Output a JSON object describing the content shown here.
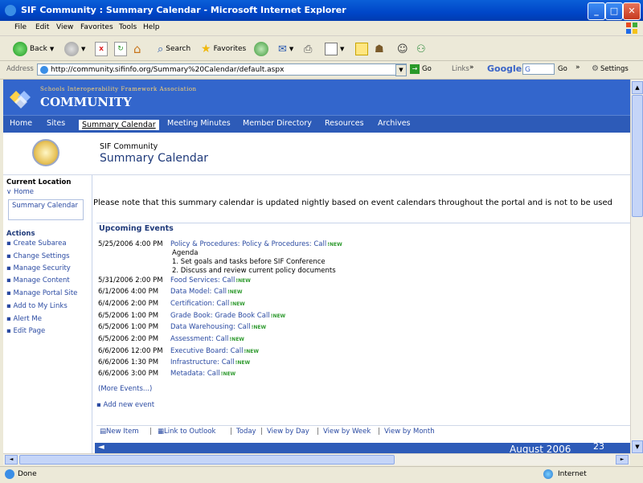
{
  "window": {
    "title": "SIF Community : Summary Calendar - Microsoft Internet Explorer"
  },
  "menu": [
    "File",
    "Edit",
    "View",
    "Favorites",
    "Tools",
    "Help"
  ],
  "toolbar": {
    "back": "Back",
    "search": "Search",
    "favorites": "Favorites"
  },
  "address": {
    "label": "Address",
    "url": "http://community.sifinfo.org/Summary%20Calendar/default.aspx",
    "go": "Go",
    "links": "Links",
    "google": "Google",
    "google_input": "G",
    "google_go": "Go",
    "settings": "Settings"
  },
  "site": {
    "logo_top": "Schools Interoperability Framework Association",
    "logo_main": "COMMUNITY",
    "nav": [
      "Home",
      "Sites",
      "Summary Calendar",
      "Meeting Minutes",
      "Member Directory",
      "Resources",
      "Archives"
    ],
    "site_name": "SIF Community",
    "page_title": "Summary Calendar"
  },
  "left": {
    "current_location": "Current Location",
    "home": "Home",
    "current": "Summary Calendar",
    "actions_title": "Actions",
    "actions": [
      "Create Subarea",
      "Change Settings",
      "Manage Security",
      "Manage Content",
      "Manage Portal Site",
      "Add to My Links",
      "Alert Me",
      "Edit Page"
    ]
  },
  "notice": "Please note that this summary calendar is updated nightly based on event calendars throughout the portal and is not to be used",
  "events": {
    "title": "Upcoming Events",
    "new_label": "NEW",
    "items": [
      {
        "date": "5/25/2006 4:00 PM",
        "title": "Policy & Procedures: Policy & Procedures: Call"
      },
      {
        "date": "5/31/2006 2:00 PM",
        "title": "Food Services: Call"
      },
      {
        "date": "6/1/2006 4:00 PM",
        "title": "Data Model: Call"
      },
      {
        "date": "6/4/2006 2:00 PM",
        "title": "Certification: Call"
      },
      {
        "date": "6/5/2006 1:00 PM",
        "title": "Grade Book: Grade Book Call"
      },
      {
        "date": "6/5/2006 1:00 PM",
        "title": "Data Warehousing: Call"
      },
      {
        "date": "6/5/2006 2:00 PM",
        "title": "Assessment: Call"
      },
      {
        "date": "6/6/2006 12:00 PM",
        "title": "Executive Board: Call"
      },
      {
        "date": "6/6/2006 1:30 PM",
        "title": "Infrastructure: Call"
      },
      {
        "date": "6/6/2006 3:00 PM",
        "title": "Metadata: Call"
      }
    ],
    "agenda": [
      "Agenda",
      "1. Set goals and tasks before SIF Conference",
      "2. Discuss and review current policy documents"
    ],
    "more": "(More Events...)",
    "add": "Add new event"
  },
  "cal_toolbar": {
    "new_item": "New Item",
    "link_outlook": "Link to Outlook",
    "today": "Today",
    "day": "View by Day",
    "week": "View by Week",
    "month": "View by Month",
    "month_title": "August 2006",
    "day_num": "23"
  },
  "status": {
    "done": "Done",
    "zone": "Internet"
  }
}
